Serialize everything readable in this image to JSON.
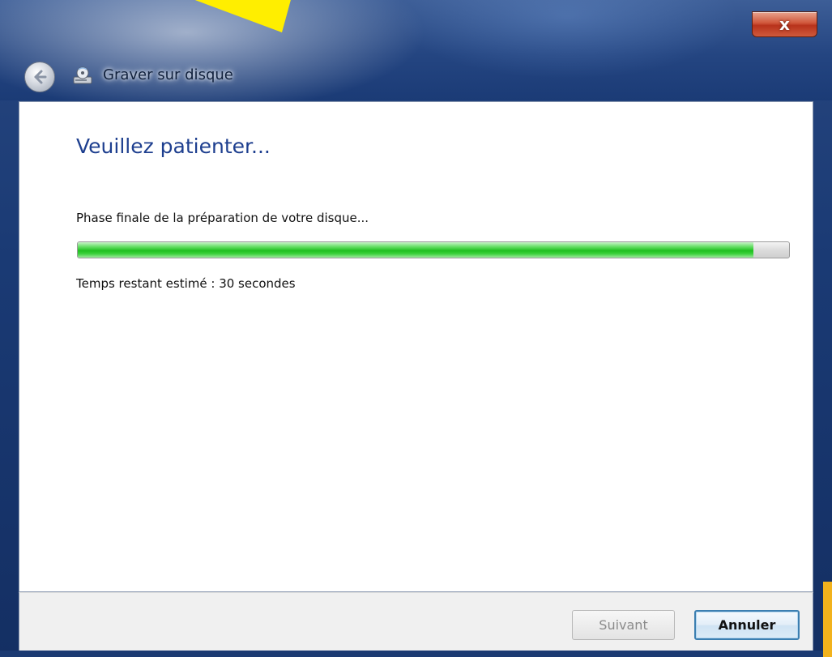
{
  "window": {
    "title": "Graver sur disque",
    "close_label": "x"
  },
  "content": {
    "heading": "Veuillez patienter...",
    "status": "Phase finale de la préparation de votre disque...",
    "progress_percent": 95,
    "time_remaining": "Temps restant estimé : 30 secondes"
  },
  "footer": {
    "next_label": "Suivant",
    "next_enabled": false,
    "cancel_label": "Annuler"
  },
  "icons": {
    "back": "back-arrow-icon",
    "header": "burn-disc-icon",
    "close": "close-icon"
  },
  "colors": {
    "heading": "#1e3f8f",
    "progress_fill": "#1fc01f",
    "annotation_arrow": "#ffee00",
    "annotation_orange": "#f2b21c"
  }
}
